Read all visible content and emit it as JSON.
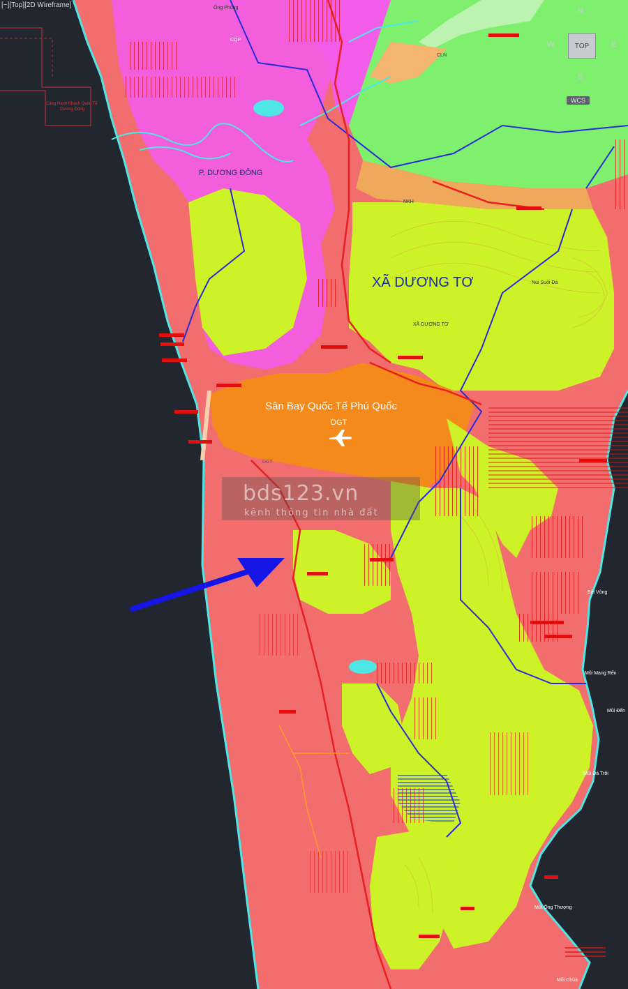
{
  "viewport": {
    "label": "[−][Top][2D Wireframe]"
  },
  "viewcube": {
    "top": "TOP",
    "north": "N",
    "south": "S",
    "east": "E",
    "west": "W",
    "wcs": "WCS"
  },
  "watermark": {
    "main": "bds123.vn",
    "sub": "kênh thông tin nhà đất"
  },
  "labels": {
    "phuong_duong_dong": "P. DƯƠNG ĐÔNG",
    "xa_duong_to": "XÃ DƯƠNG TƠ",
    "xa_duong_to_small": "XÃ DƯƠNG TƠ",
    "airport": "Sân Bay Quốc Tế Phú Quốc",
    "airport_code": "DGT",
    "dgt_small": "DGT",
    "cang_hanh_khach": "Cảng Hành Khách Quốc Tế",
    "cang_sub": "Dương Đông",
    "ong_phung": "Ông Phùng",
    "bai_vong": "Bãi Vòng",
    "mui_mang_ren": "Mũi Mang Rến",
    "mui_den": "Mũi Đển",
    "mui_da_troi": "Mũi Đá Trôi",
    "mui_ong_thuong": "Mũi Ông Thượng",
    "mui_chua": "Mũi Chùa",
    "cqp": "CQP",
    "nui_sau_da": "Núi Suối Đá",
    "cln": "CLN",
    "nkh": "NKH"
  },
  "colors": {
    "background": "#22272f",
    "urban": "#f26d6d",
    "forest": "#cdf227",
    "airport": "#f58a1c",
    "agri_green": "#7ef06e",
    "magenta": "#f25ce8",
    "arrow": "#1515e6",
    "boundary": "#2a2ad8",
    "road": "#e62020",
    "water": "#4fe6e6"
  },
  "legend_icons": {
    "airplane": "airplane-icon",
    "arrow": "location-arrow-icon"
  }
}
